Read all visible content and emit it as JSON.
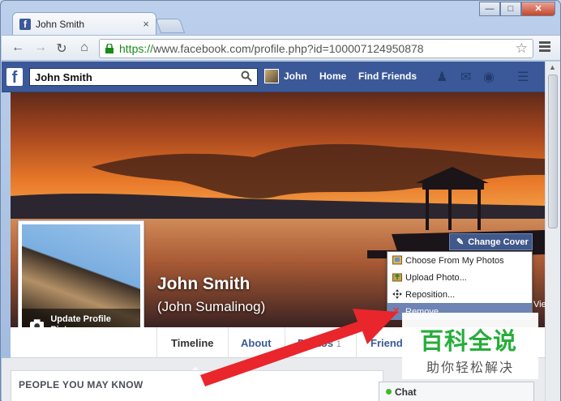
{
  "browser": {
    "tab_title": "John Smith",
    "tab_close": "×",
    "url_https": "https://",
    "url_rest": "www.facebook.com/profile.php?id=100007124950878",
    "window_buttons": {
      "minimize": "—",
      "maximize": "□",
      "close": "✕"
    }
  },
  "fb_header": {
    "search_value": "John Smith",
    "nav_name": "John",
    "nav_home": "Home",
    "nav_find_friends": "Find Friends"
  },
  "profile": {
    "name": "John Smith",
    "alt_name": "(John Sumalinog)",
    "update_picture": "Update Profile Picture",
    "change_cover": "Change Cover",
    "view_label": "Vie",
    "cover_menu": [
      {
        "label": "Choose From My Photos",
        "icon": "photo-album-icon"
      },
      {
        "label": "Upload Photo...",
        "icon": "upload-photo-icon"
      },
      {
        "label": "Reposition...",
        "icon": "move-arrows-icon"
      },
      {
        "label": "Remove",
        "icon": "remove-x-icon"
      }
    ],
    "tabs": [
      {
        "label": "Timeline"
      },
      {
        "label": "About"
      },
      {
        "label": "Photos",
        "count": "1"
      },
      {
        "label": "Friends"
      }
    ]
  },
  "sidebar": {
    "people_you_may_know": "PEOPLE YOU MAY KNOW"
  },
  "chat": {
    "label": "Chat"
  },
  "watermark": {
    "title": "百科全说",
    "subtitle": "助你轻松解决"
  },
  "colors": {
    "facebook_blue": "#3b5998",
    "menu_highlight": "#6d84b4",
    "arrow_red": "#e8262b",
    "watermark_green": "#27ad3a"
  }
}
